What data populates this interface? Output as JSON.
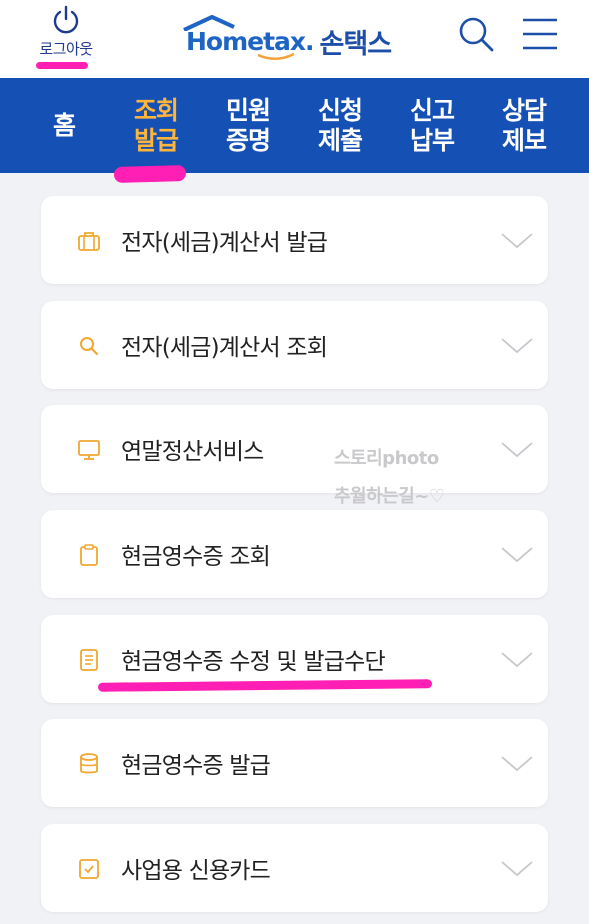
{
  "header": {
    "logout_label": "로그아웃",
    "logo_text": "Hometax.",
    "logo_ko": "손택스",
    "colors": {
      "brand": "#1d64c5",
      "nav_bg": "#1550b4",
      "active": "#ffb43a",
      "icon": "#f0a830",
      "highlight": "#ff1fb4"
    }
  },
  "nav": {
    "items": [
      {
        "line1": "홈",
        "line2": ""
      },
      {
        "line1": "조회",
        "line2": "발급"
      },
      {
        "line1": "민원",
        "line2": "증명"
      },
      {
        "line1": "신청",
        "line2": "제출"
      },
      {
        "line1": "신고",
        "line2": "납부"
      },
      {
        "line1": "상담",
        "line2": "제보"
      }
    ],
    "active_index": 1
  },
  "menu": {
    "items": [
      {
        "label": "전자(세금)계산서 발급",
        "icon": "briefcase-icon"
      },
      {
        "label": "전자(세금)계산서 조회",
        "icon": "search-icon"
      },
      {
        "label": "연말정산서비스",
        "icon": "monitor-icon"
      },
      {
        "label": "현금영수증 조회",
        "icon": "clipboard-icon"
      },
      {
        "label": "현금영수증 수정 및 발급수단",
        "icon": "document-icon"
      },
      {
        "label": "현금영수증 발급",
        "icon": "database-icon"
      },
      {
        "label": "사업용 신용카드",
        "icon": "checkbox-icon"
      }
    ]
  },
  "watermark": {
    "line1": "스토리photo",
    "line2": "추월하는길~♡"
  }
}
